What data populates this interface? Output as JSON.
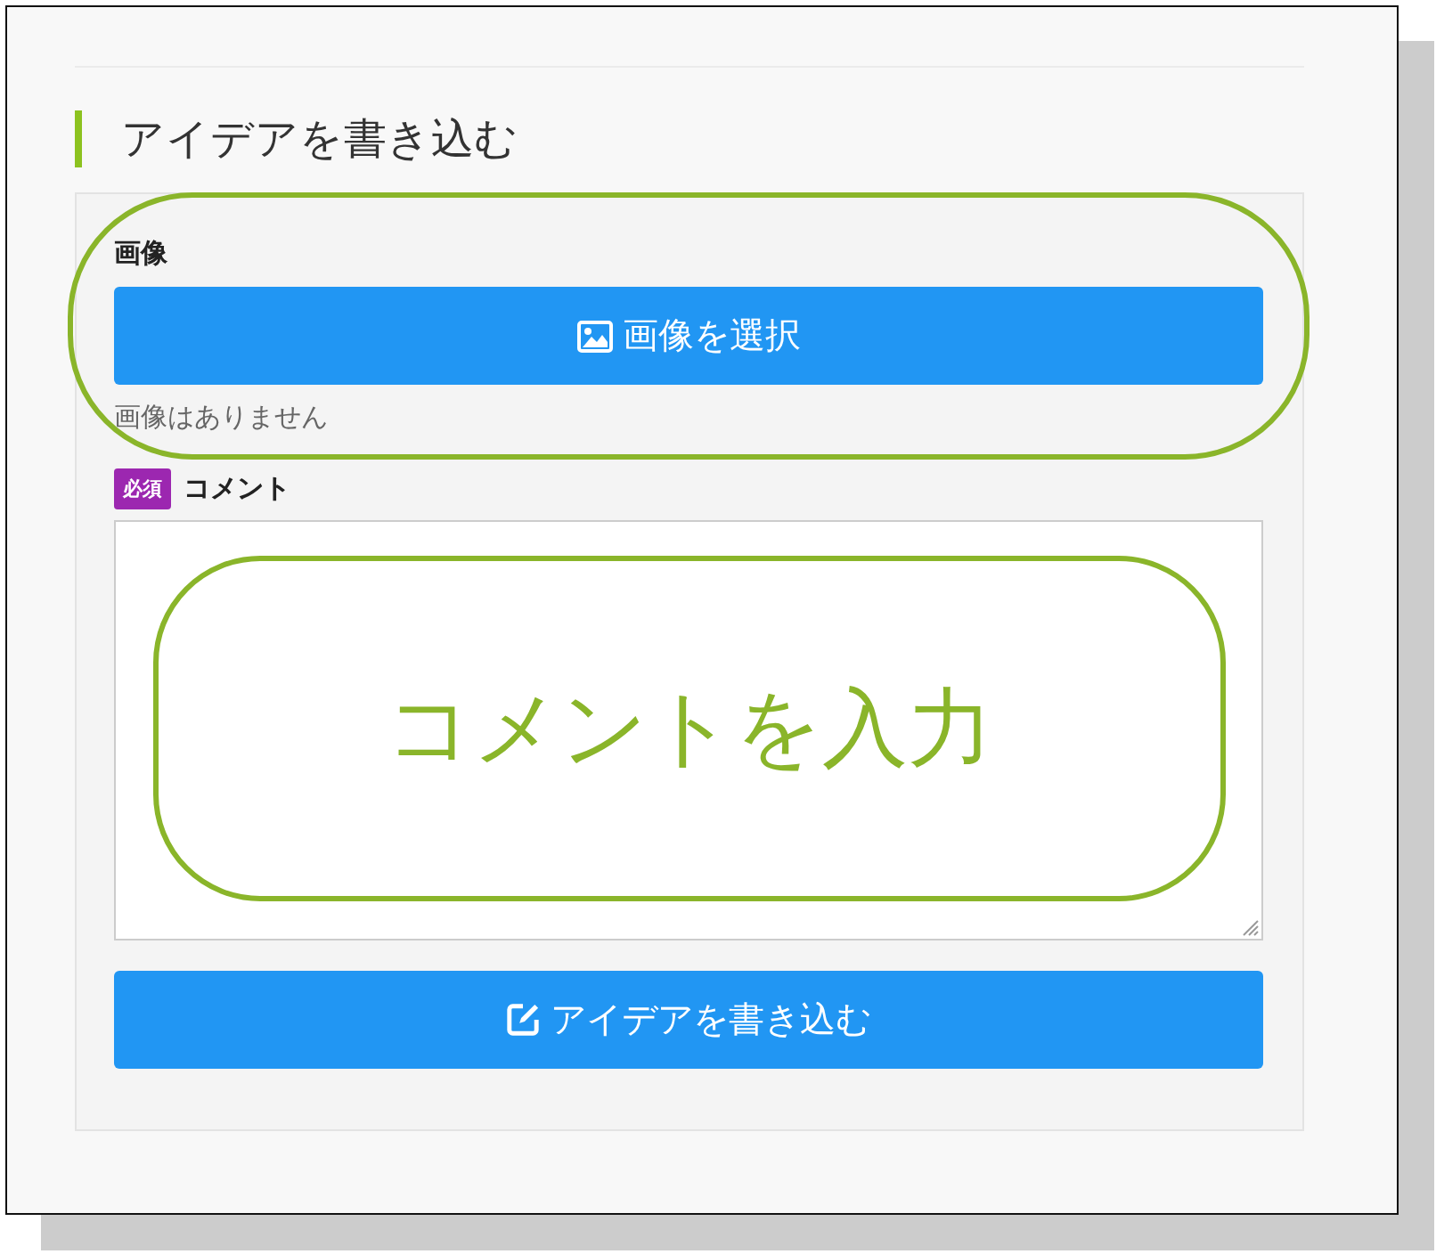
{
  "section_title": "アイデアを書き込む",
  "image_field": {
    "label": "画像",
    "button": "画像を選択",
    "status": "画像はありません",
    "highlighted": true
  },
  "comment_field": {
    "required_badge": "必須",
    "label": "コメント",
    "callout": "コメントを入力"
  },
  "submit_button": "アイデアを書き込む"
}
